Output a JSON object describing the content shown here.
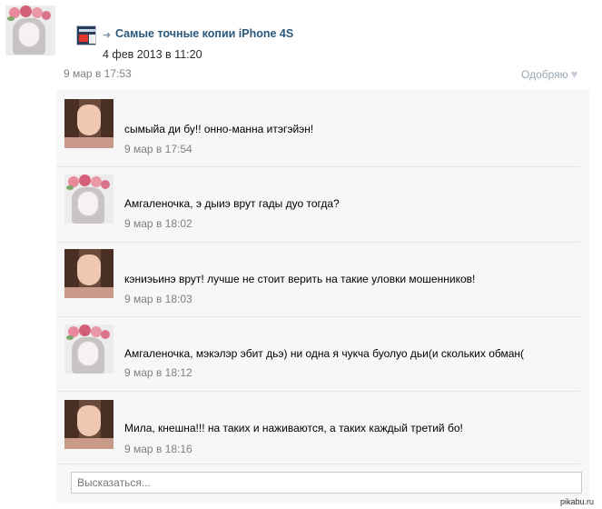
{
  "post": {
    "repost_title": "Самые точные копии iPhone 4S",
    "repost_date": "4 фев 2013 в 11:20",
    "time": "9 мар в 17:53",
    "like_label": "Одобряю"
  },
  "replies": [
    {
      "text": "сымыйа ди бу!! онно-манна итэгэйэн!",
      "time": "9 мар в 17:54",
      "avatar": "girl"
    },
    {
      "text": "Амгаленочка, э дыиэ врут гады дуо тогда?",
      "time": "9 мар в 18:02",
      "avatar": "flowers"
    },
    {
      "text": "кэниэьинэ врут! лучше не стоит верить на такие уловки мошенников!",
      "time": "9 мар в 18:03",
      "avatar": "girl"
    },
    {
      "text": "Амгаленочка, мэкэлэр эбит дьэ) ни одна я чукча буолуо дьи(и скольких обман(",
      "time": "9 мар в 18:12",
      "avatar": "flowers"
    },
    {
      "text": "Мила, кнешна!!! на таких и наживаются, а таких каждый третий бо!",
      "time": "9 мар в 18:16",
      "avatar": "girl"
    }
  ],
  "reply_box": {
    "placeholder": "Высказаться..."
  },
  "watermark": "pikabu.ru"
}
